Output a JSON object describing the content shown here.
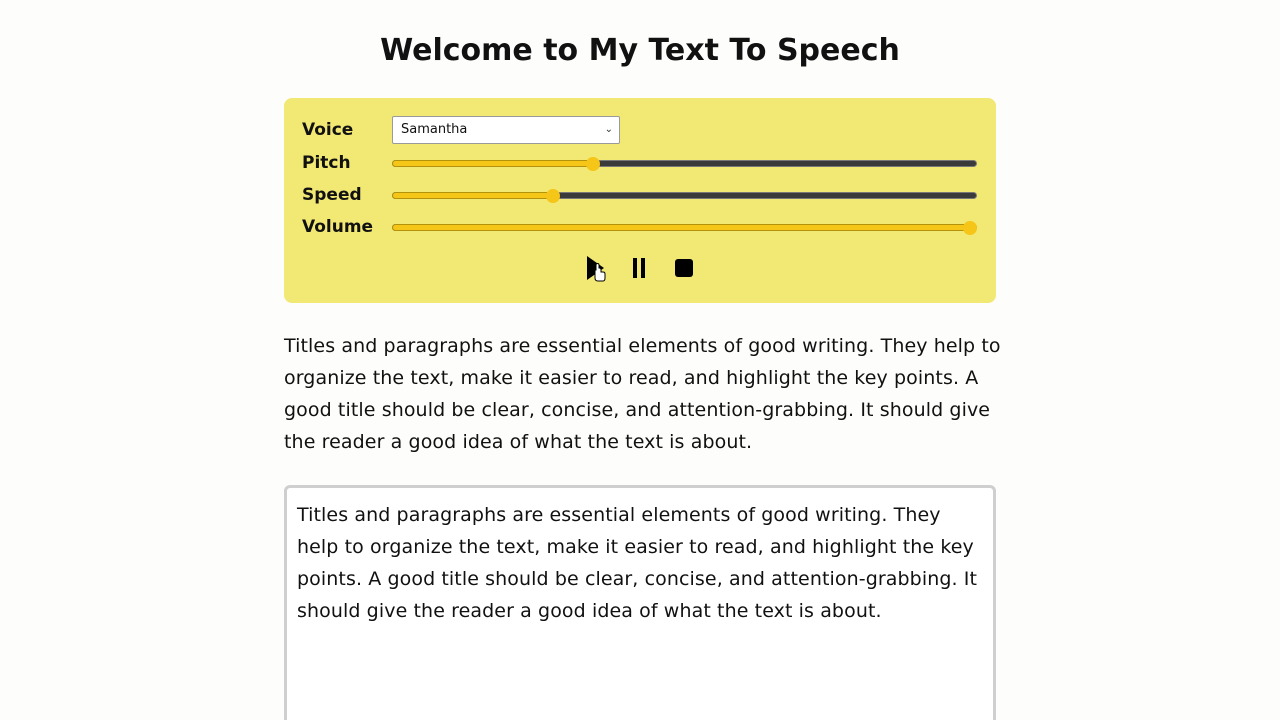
{
  "page": {
    "title": "Welcome to My Text To Speech",
    "paragraph": "Titles and paragraphs are essential elements of good writing. They help to organize the text, make it easier to read, and highlight the key points. A good title should be clear, concise, and attention-grabbing. It should give the reader a good idea of what the text is about."
  },
  "controls": {
    "voice": {
      "label": "Voice",
      "selected": "Samantha"
    },
    "pitch": {
      "label": "Pitch",
      "value_fraction": 0.34
    },
    "speed": {
      "label": "Speed",
      "value_fraction": 0.27
    },
    "volume": {
      "label": "Volume",
      "value_fraction": 1.0
    },
    "buttons": [
      "play-icon",
      "pause-icon",
      "stop-icon"
    ]
  },
  "textarea": {
    "value": "Titles and paragraphs are essential elements of good writing. They help to organize the text, make it easier to read, and highlight the key points. A good title should be clear, concise, and attention-grabbing. It should give the reader a good idea of what the text is about."
  },
  "colors": {
    "panel": "#f2e874",
    "accent": "#f5c518",
    "track": "#3a3a3a"
  }
}
